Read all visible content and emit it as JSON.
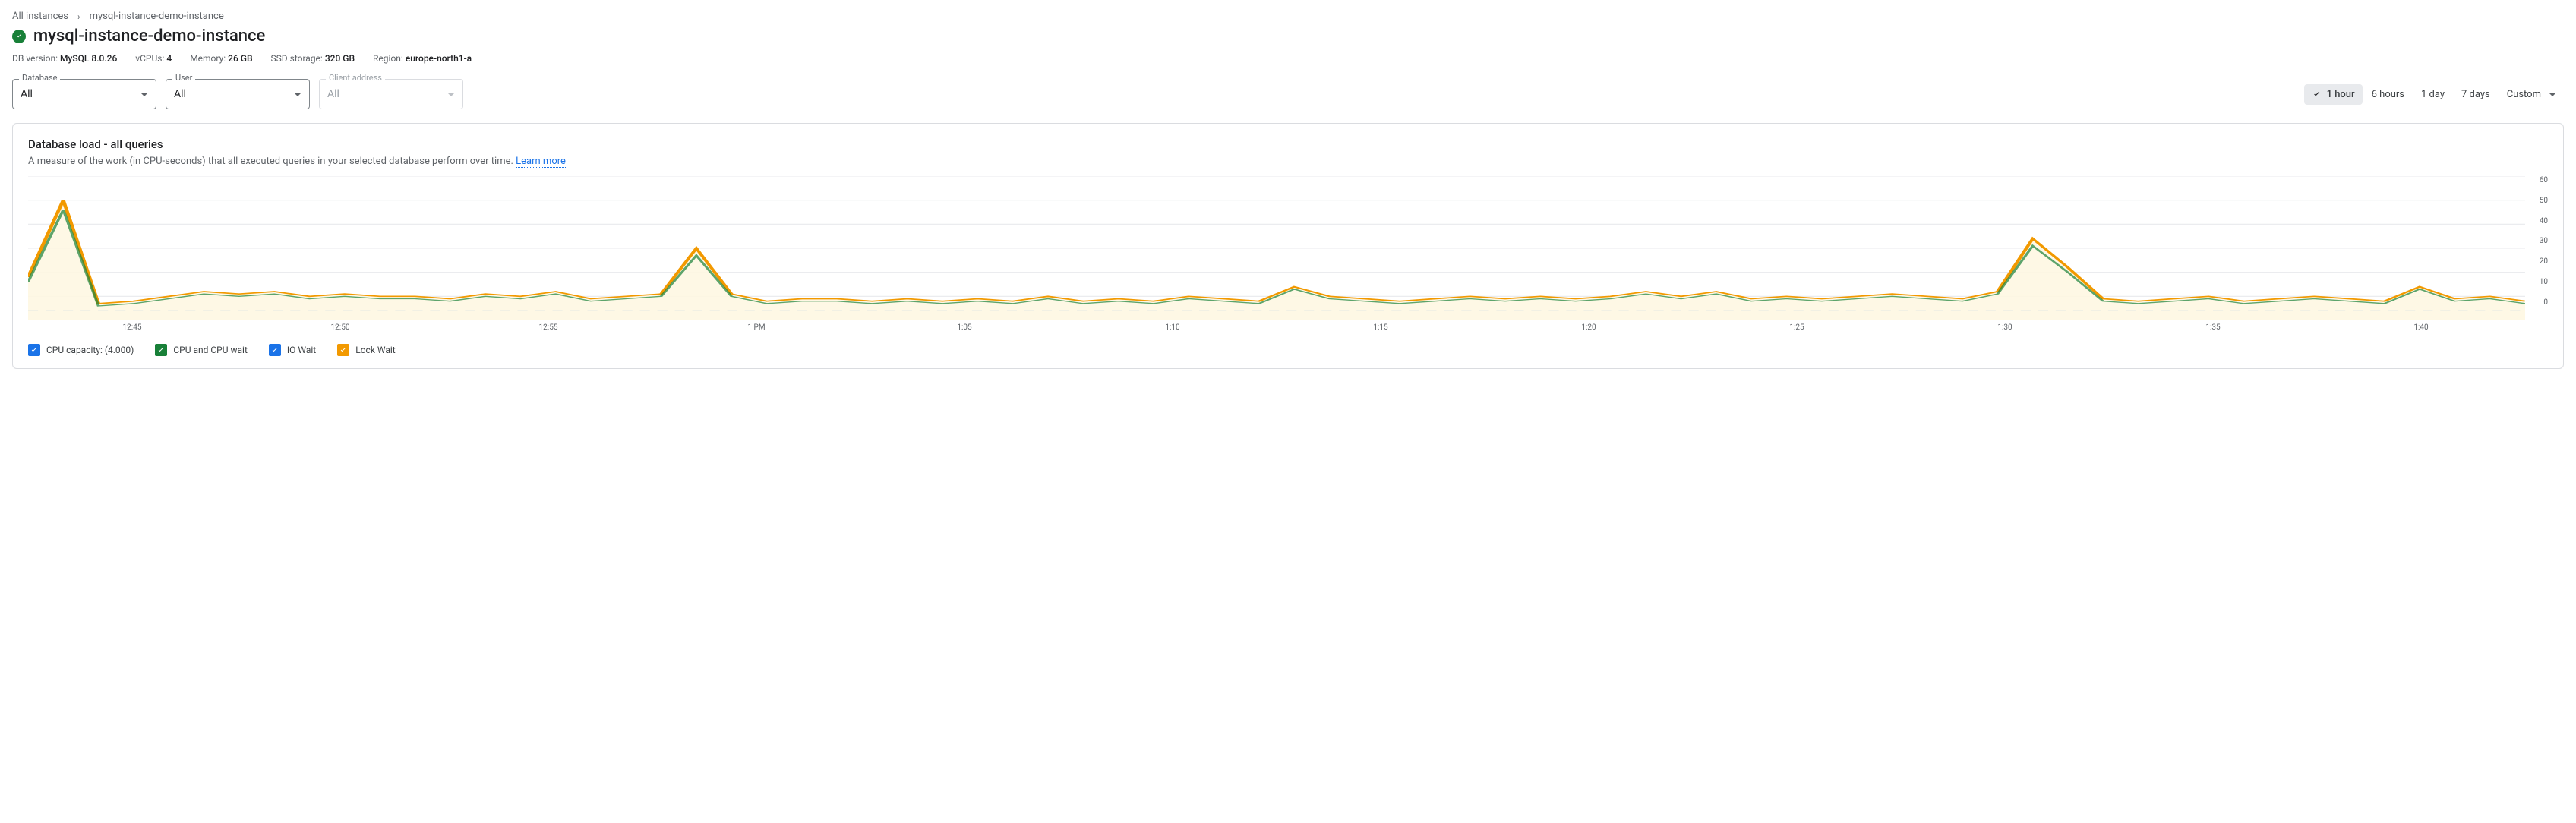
{
  "breadcrumb": {
    "root": "All instances",
    "current": "mysql-instance-demo-instance"
  },
  "title": "mysql-instance-demo-instance",
  "meta": {
    "db_version_label": "DB version:",
    "db_version": "MySQL 8.0.26",
    "vcpus_label": "vCPUs:",
    "vcpus": "4",
    "memory_label": "Memory:",
    "memory": "26 GB",
    "ssd_label": "SSD storage:",
    "ssd": "320 GB",
    "region_label": "Region:",
    "region": "europe-north1-a"
  },
  "filters": {
    "database_label": "Database",
    "database_value": "All",
    "user_label": "User",
    "user_value": "All",
    "client_label": "Client address",
    "client_value": "All"
  },
  "time_range": {
    "opts": [
      "1 hour",
      "6 hours",
      "1 day",
      "7 days"
    ],
    "custom": "Custom",
    "selected": "1 hour"
  },
  "card": {
    "title": "Database load - all queries",
    "desc": "A measure of the work (in CPU-seconds) that all executed queries in your selected database perform over time.",
    "learn_more": "Learn more"
  },
  "legend": {
    "cpu_capacity": "CPU capacity: (4.000)",
    "cpu_wait": "CPU and CPU wait",
    "io_wait": "IO Wait",
    "lock_wait": "Lock Wait"
  },
  "chart_data": {
    "type": "area",
    "title": "Database load - all queries",
    "xlabel": "",
    "ylabel": "",
    "ylim": [
      0,
      60
    ],
    "y_ticks": [
      "60",
      "50",
      "40",
      "30",
      "20",
      "10",
      "0"
    ],
    "x_ticks": [
      "12:45",
      "12:50",
      "12:55",
      "1 PM",
      "1:05",
      "1:10",
      "1:15",
      "1:20",
      "1:25",
      "1:30",
      "1:35",
      "1:40"
    ],
    "cpu_capacity": 4,
    "series": [
      {
        "name": "Lock Wait",
        "color": "#f29900",
        "values": [
          18,
          50,
          7,
          8,
          10,
          12,
          11,
          12,
          10,
          11,
          10,
          10,
          9,
          11,
          10,
          12,
          9,
          10,
          11,
          30,
          11,
          8,
          9,
          9,
          8,
          9,
          8,
          9,
          8,
          10,
          8,
          9,
          8,
          10,
          9,
          8,
          14,
          10,
          9,
          8,
          9,
          10,
          9,
          10,
          9,
          10,
          12,
          10,
          12,
          9,
          10,
          9,
          10,
          11,
          10,
          9,
          12,
          34,
          22,
          9,
          8,
          9,
          10,
          8,
          9,
          10,
          9,
          8,
          14,
          9,
          10,
          8
        ]
      },
      {
        "name": "CPU and CPU wait",
        "color": "#188038",
        "values": [
          16,
          46,
          6,
          7,
          9,
          11,
          10,
          11,
          9,
          10,
          9,
          9,
          8,
          10,
          9,
          11,
          8,
          9,
          10,
          27,
          10,
          7,
          8,
          8,
          7,
          8,
          7,
          8,
          7,
          9,
          7,
          8,
          7,
          9,
          8,
          7,
          13,
          9,
          8,
          7,
          8,
          9,
          8,
          9,
          8,
          9,
          11,
          9,
          11,
          8,
          9,
          8,
          9,
          10,
          9,
          8,
          11,
          31,
          20,
          8,
          7,
          8,
          9,
          7,
          8,
          9,
          8,
          7,
          13,
          8,
          9,
          7
        ]
      },
      {
        "name": "IO Wait",
        "color": "#1a73e8",
        "values": [
          0,
          0,
          0,
          0,
          0,
          0,
          0,
          0,
          0,
          0,
          0,
          0,
          0,
          0,
          0,
          0,
          0,
          0,
          0,
          0,
          0,
          0,
          0,
          0,
          0,
          0,
          0,
          0,
          0,
          0,
          0,
          0,
          0,
          0,
          0,
          0,
          0,
          0,
          0,
          0,
          0,
          0,
          0,
          0,
          0,
          0,
          0,
          0,
          0,
          0,
          0,
          0,
          0,
          0,
          0,
          0,
          0,
          0,
          0,
          0,
          0,
          0,
          0,
          0,
          0,
          0,
          0,
          0,
          0,
          0,
          0,
          0
        ]
      }
    ]
  }
}
